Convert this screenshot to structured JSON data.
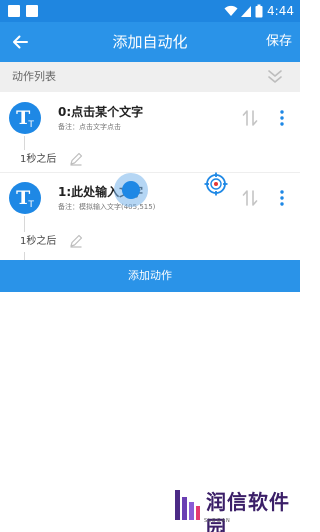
{
  "status_bar": {
    "time": "4:44",
    "icons": [
      "notification-square-icon",
      "notification-square-icon",
      "wifi-icon",
      "signal-icon",
      "battery-icon"
    ]
  },
  "toolbar": {
    "title": "添加自动化",
    "save_label": "保存",
    "back_icon": "arrow-left-icon",
    "background": "#2a93e8"
  },
  "section": {
    "title": "动作列表",
    "collapse_icon": "double-chevron-down-icon"
  },
  "actions": [
    {
      "avatar_letter": "T",
      "avatar_sub": "T",
      "title": "0:点击某个文字",
      "note": "备注：点击文字点击",
      "delay": "1秒之后"
    },
    {
      "avatar_letter": "T",
      "avatar_sub": "T",
      "title": "1:此处输入文字",
      "note": "备注：模拟输入文字(405,515)",
      "delay": "1秒之后"
    }
  ],
  "add_button": {
    "label": "添加动作"
  },
  "watermark": {
    "text": "润信软件园",
    "slogan": "SLOGAN"
  },
  "colors": {
    "primary": "#2a93e8",
    "avatar": "#1e88e5",
    "target_ring": "#1e88e5",
    "target_center": "#e53935"
  }
}
